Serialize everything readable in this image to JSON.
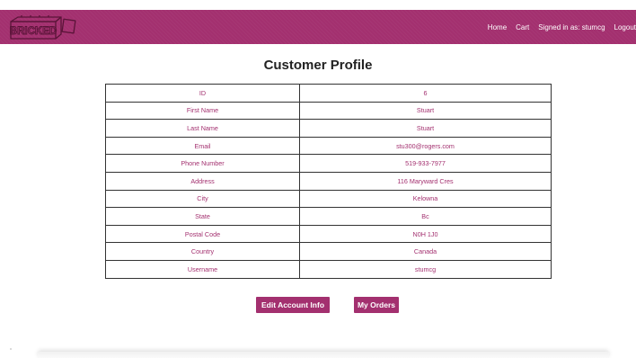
{
  "brand": {
    "logo_text": "BRICKED",
    "logo_icon": "brick-logo-icon"
  },
  "nav": {
    "home": "Home",
    "cart": "Cart",
    "signed_in": "Signed in as: stumcg",
    "logout": "Logout"
  },
  "page": {
    "title": "Customer Profile"
  },
  "profile": {
    "rows": [
      {
        "label": "ID",
        "value": "6"
      },
      {
        "label": "First Name",
        "value": "Stuart"
      },
      {
        "label": "Last Name",
        "value": "Stuart"
      },
      {
        "label": "Email",
        "value": "stu300@rogers.com"
      },
      {
        "label": "Phone Number",
        "value": "519-933-7977"
      },
      {
        "label": "Address",
        "value": "116 Maryward Cres"
      },
      {
        "label": "City",
        "value": "Kelowna"
      },
      {
        "label": "State",
        "value": "Bc"
      },
      {
        "label": "Postal Code",
        "value": "N0H 1J0"
      },
      {
        "label": "Country",
        "value": "Canada"
      },
      {
        "label": "Username",
        "value": "stumcg"
      }
    ]
  },
  "actions": {
    "edit_label": "Edit Account Info",
    "orders_label": "My Orders"
  },
  "colors": {
    "brand": "#a3306f",
    "text_on_brand": "#ffffff",
    "border": "#333333"
  }
}
